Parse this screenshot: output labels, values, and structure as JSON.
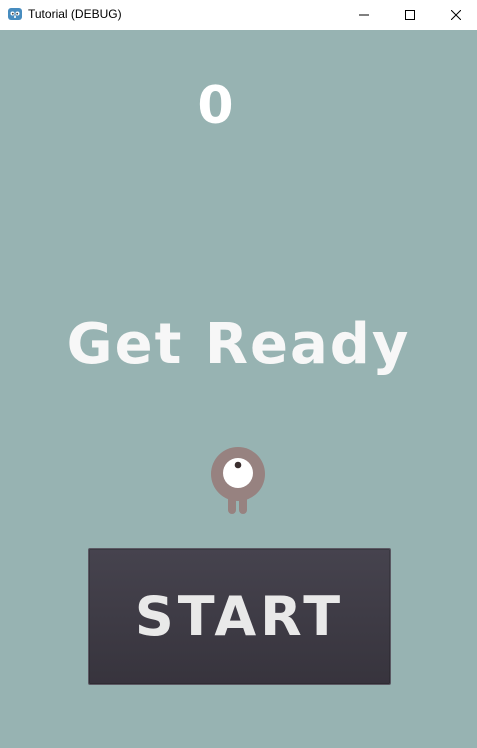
{
  "window": {
    "title": "Tutorial (DEBUG)",
    "icon": "godot-engine-icon",
    "controls": {
      "minimize_icon": "minimize-icon",
      "maximize_icon": "maximize-icon",
      "close_icon": "close-icon"
    }
  },
  "game": {
    "score": "0",
    "status_text": "Get Ready",
    "start_button_label": "START",
    "player_icon": "one-eyed-creature"
  },
  "colors": {
    "background": "#97b3b2",
    "button": "#3f3c45",
    "text": "#ffffff",
    "player": "#978280"
  }
}
